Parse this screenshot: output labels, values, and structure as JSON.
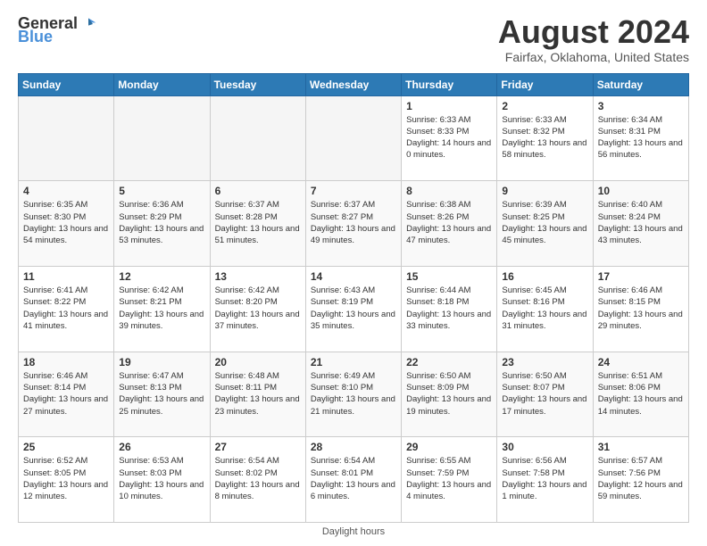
{
  "header": {
    "logo_general": "General",
    "logo_blue": "Blue",
    "month_title": "August 2024",
    "subtitle": "Fairfax, Oklahoma, United States"
  },
  "days_of_week": [
    "Sunday",
    "Monday",
    "Tuesday",
    "Wednesday",
    "Thursday",
    "Friday",
    "Saturday"
  ],
  "footer": {
    "daylight_hours": "Daylight hours"
  },
  "weeks": [
    [
      {
        "day": "",
        "sunrise": "",
        "sunset": "",
        "daylight": "",
        "empty": true
      },
      {
        "day": "",
        "sunrise": "",
        "sunset": "",
        "daylight": "",
        "empty": true
      },
      {
        "day": "",
        "sunrise": "",
        "sunset": "",
        "daylight": "",
        "empty": true
      },
      {
        "day": "",
        "sunrise": "",
        "sunset": "",
        "daylight": "",
        "empty": true
      },
      {
        "day": "1",
        "sunrise": "Sunrise: 6:33 AM",
        "sunset": "Sunset: 8:33 PM",
        "daylight": "Daylight: 14 hours and 0 minutes.",
        "empty": false
      },
      {
        "day": "2",
        "sunrise": "Sunrise: 6:33 AM",
        "sunset": "Sunset: 8:32 PM",
        "daylight": "Daylight: 13 hours and 58 minutes.",
        "empty": false
      },
      {
        "day": "3",
        "sunrise": "Sunrise: 6:34 AM",
        "sunset": "Sunset: 8:31 PM",
        "daylight": "Daylight: 13 hours and 56 minutes.",
        "empty": false
      }
    ],
    [
      {
        "day": "4",
        "sunrise": "Sunrise: 6:35 AM",
        "sunset": "Sunset: 8:30 PM",
        "daylight": "Daylight: 13 hours and 54 minutes.",
        "empty": false
      },
      {
        "day": "5",
        "sunrise": "Sunrise: 6:36 AM",
        "sunset": "Sunset: 8:29 PM",
        "daylight": "Daylight: 13 hours and 53 minutes.",
        "empty": false
      },
      {
        "day": "6",
        "sunrise": "Sunrise: 6:37 AM",
        "sunset": "Sunset: 8:28 PM",
        "daylight": "Daylight: 13 hours and 51 minutes.",
        "empty": false
      },
      {
        "day": "7",
        "sunrise": "Sunrise: 6:37 AM",
        "sunset": "Sunset: 8:27 PM",
        "daylight": "Daylight: 13 hours and 49 minutes.",
        "empty": false
      },
      {
        "day": "8",
        "sunrise": "Sunrise: 6:38 AM",
        "sunset": "Sunset: 8:26 PM",
        "daylight": "Daylight: 13 hours and 47 minutes.",
        "empty": false
      },
      {
        "day": "9",
        "sunrise": "Sunrise: 6:39 AM",
        "sunset": "Sunset: 8:25 PM",
        "daylight": "Daylight: 13 hours and 45 minutes.",
        "empty": false
      },
      {
        "day": "10",
        "sunrise": "Sunrise: 6:40 AM",
        "sunset": "Sunset: 8:24 PM",
        "daylight": "Daylight: 13 hours and 43 minutes.",
        "empty": false
      }
    ],
    [
      {
        "day": "11",
        "sunrise": "Sunrise: 6:41 AM",
        "sunset": "Sunset: 8:22 PM",
        "daylight": "Daylight: 13 hours and 41 minutes.",
        "empty": false
      },
      {
        "day": "12",
        "sunrise": "Sunrise: 6:42 AM",
        "sunset": "Sunset: 8:21 PM",
        "daylight": "Daylight: 13 hours and 39 minutes.",
        "empty": false
      },
      {
        "day": "13",
        "sunrise": "Sunrise: 6:42 AM",
        "sunset": "Sunset: 8:20 PM",
        "daylight": "Daylight: 13 hours and 37 minutes.",
        "empty": false
      },
      {
        "day": "14",
        "sunrise": "Sunrise: 6:43 AM",
        "sunset": "Sunset: 8:19 PM",
        "daylight": "Daylight: 13 hours and 35 minutes.",
        "empty": false
      },
      {
        "day": "15",
        "sunrise": "Sunrise: 6:44 AM",
        "sunset": "Sunset: 8:18 PM",
        "daylight": "Daylight: 13 hours and 33 minutes.",
        "empty": false
      },
      {
        "day": "16",
        "sunrise": "Sunrise: 6:45 AM",
        "sunset": "Sunset: 8:16 PM",
        "daylight": "Daylight: 13 hours and 31 minutes.",
        "empty": false
      },
      {
        "day": "17",
        "sunrise": "Sunrise: 6:46 AM",
        "sunset": "Sunset: 8:15 PM",
        "daylight": "Daylight: 13 hours and 29 minutes.",
        "empty": false
      }
    ],
    [
      {
        "day": "18",
        "sunrise": "Sunrise: 6:46 AM",
        "sunset": "Sunset: 8:14 PM",
        "daylight": "Daylight: 13 hours and 27 minutes.",
        "empty": false
      },
      {
        "day": "19",
        "sunrise": "Sunrise: 6:47 AM",
        "sunset": "Sunset: 8:13 PM",
        "daylight": "Daylight: 13 hours and 25 minutes.",
        "empty": false
      },
      {
        "day": "20",
        "sunrise": "Sunrise: 6:48 AM",
        "sunset": "Sunset: 8:11 PM",
        "daylight": "Daylight: 13 hours and 23 minutes.",
        "empty": false
      },
      {
        "day": "21",
        "sunrise": "Sunrise: 6:49 AM",
        "sunset": "Sunset: 8:10 PM",
        "daylight": "Daylight: 13 hours and 21 minutes.",
        "empty": false
      },
      {
        "day": "22",
        "sunrise": "Sunrise: 6:50 AM",
        "sunset": "Sunset: 8:09 PM",
        "daylight": "Daylight: 13 hours and 19 minutes.",
        "empty": false
      },
      {
        "day": "23",
        "sunrise": "Sunrise: 6:50 AM",
        "sunset": "Sunset: 8:07 PM",
        "daylight": "Daylight: 13 hours and 17 minutes.",
        "empty": false
      },
      {
        "day": "24",
        "sunrise": "Sunrise: 6:51 AM",
        "sunset": "Sunset: 8:06 PM",
        "daylight": "Daylight: 13 hours and 14 minutes.",
        "empty": false
      }
    ],
    [
      {
        "day": "25",
        "sunrise": "Sunrise: 6:52 AM",
        "sunset": "Sunset: 8:05 PM",
        "daylight": "Daylight: 13 hours and 12 minutes.",
        "empty": false
      },
      {
        "day": "26",
        "sunrise": "Sunrise: 6:53 AM",
        "sunset": "Sunset: 8:03 PM",
        "daylight": "Daylight: 13 hours and 10 minutes.",
        "empty": false
      },
      {
        "day": "27",
        "sunrise": "Sunrise: 6:54 AM",
        "sunset": "Sunset: 8:02 PM",
        "daylight": "Daylight: 13 hours and 8 minutes.",
        "empty": false
      },
      {
        "day": "28",
        "sunrise": "Sunrise: 6:54 AM",
        "sunset": "Sunset: 8:01 PM",
        "daylight": "Daylight: 13 hours and 6 minutes.",
        "empty": false
      },
      {
        "day": "29",
        "sunrise": "Sunrise: 6:55 AM",
        "sunset": "Sunset: 7:59 PM",
        "daylight": "Daylight: 13 hours and 4 minutes.",
        "empty": false
      },
      {
        "day": "30",
        "sunrise": "Sunrise: 6:56 AM",
        "sunset": "Sunset: 7:58 PM",
        "daylight": "Daylight: 13 hours and 1 minute.",
        "empty": false
      },
      {
        "day": "31",
        "sunrise": "Sunrise: 6:57 AM",
        "sunset": "Sunset: 7:56 PM",
        "daylight": "Daylight: 12 hours and 59 minutes.",
        "empty": false
      }
    ]
  ]
}
